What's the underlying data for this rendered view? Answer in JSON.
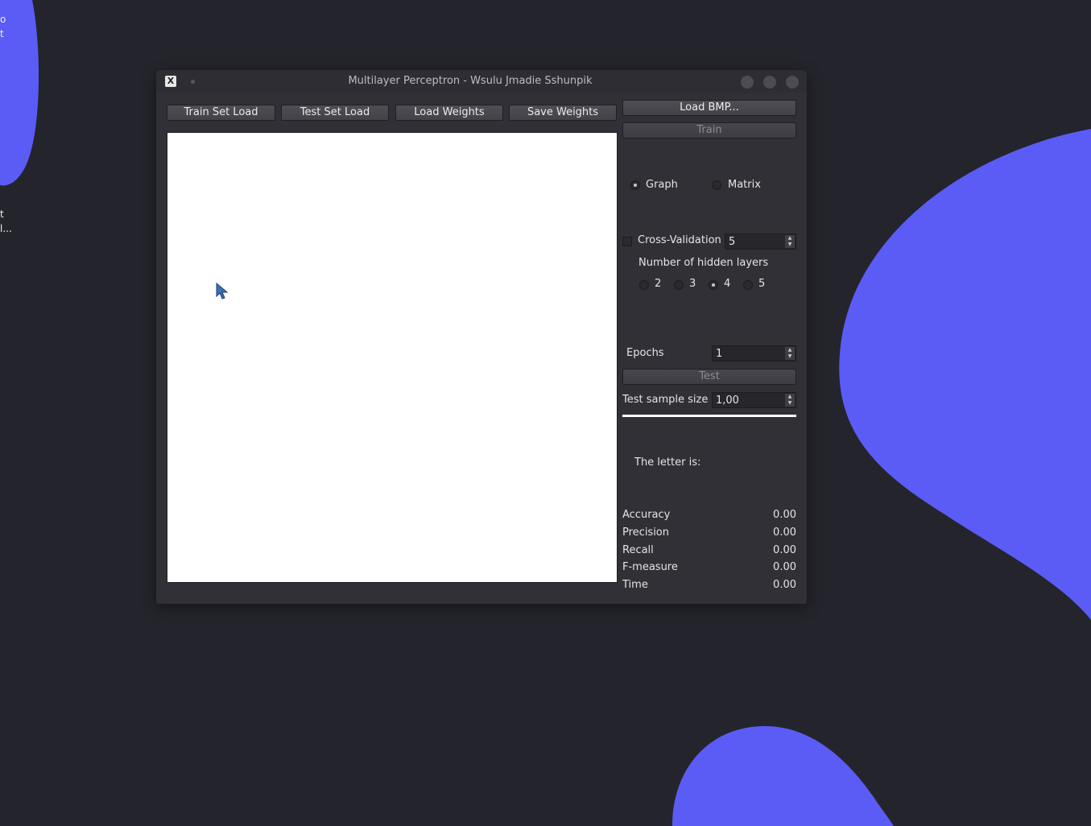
{
  "desktop": {
    "labels": [
      "o",
      "t",
      "t",
      "l..."
    ]
  },
  "window": {
    "title": "Multilayer Perceptron - Wsulu Jmadie Sshunpik",
    "app_icon": "x-app-icon"
  },
  "toolbar": {
    "train_set_load": "Train Set Load",
    "test_set_load": "Test Set Load",
    "load_weights": "Load Weights",
    "save_weights": "Save Weights"
  },
  "side": {
    "load_bmp": "Load BMP...",
    "train": "Train",
    "view_graph": "Graph",
    "view_matrix": "Matrix",
    "view_selected": "Graph",
    "cross_validation": "Cross-Validation",
    "cross_validation_checked": false,
    "cross_validation_value": "5",
    "hidden_layers_label": "Number of hidden layers",
    "hidden_layers_options": [
      "2",
      "3",
      "4",
      "5"
    ],
    "hidden_layers_selected": "4",
    "epochs_label": "Epochs",
    "epochs_value": "1",
    "test": "Test",
    "test_sample_label": "Test sample size",
    "test_sample_value": "1,00",
    "progress": 1.0,
    "letter_label": "The letter is:"
  },
  "metrics": [
    {
      "name": "Accuracy",
      "value": "0.00"
    },
    {
      "name": "Precision",
      "value": "0.00"
    },
    {
      "name": "Recall",
      "value": "0.00"
    },
    {
      "name": "F-measure",
      "value": "0.00"
    },
    {
      "name": "Time",
      "value": "0.00"
    }
  ],
  "colors": {
    "desktop_bg": "#24242c",
    "accent_blob": "#5b5cf6",
    "window_bg": "#303036"
  }
}
